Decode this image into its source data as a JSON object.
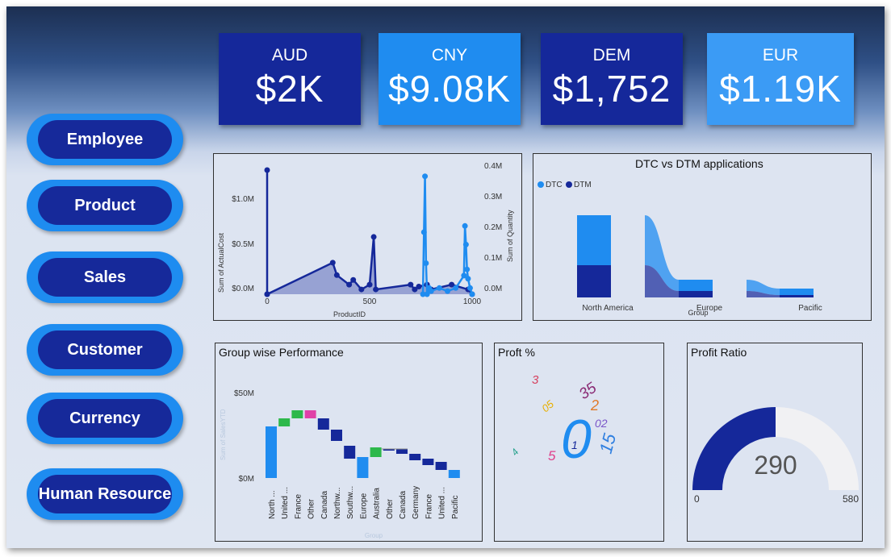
{
  "kpis": [
    {
      "code": "AUD",
      "value": "$2K",
      "color": "#15289a"
    },
    {
      "code": "CNY",
      "value": "$9.08K",
      "color": "#1f8cf0"
    },
    {
      "code": "DEM",
      "value": "$1,752",
      "color": "#15289a"
    },
    {
      "code": "EUR",
      "value": "$1.19K",
      "color": "#3b9bf5"
    }
  ],
  "nav": [
    "Employee",
    "Product",
    "Sales",
    "Customer",
    "Currency",
    "Human Resource"
  ],
  "colors": {
    "dark_blue": "#15289a",
    "mid_blue": "#1f8cf0",
    "light_blue": "#3b9bf5",
    "green": "#2db84b",
    "pink": "#e040a8"
  },
  "cost_chart": {
    "chart_data": {
      "type": "line",
      "xlabel": "ProductID",
      "ylabel": "Sum of ActualCost",
      "y2label": "Sum of Quantity",
      "xticks": [
        "0",
        "500",
        "1000"
      ],
      "yticks": [
        "$0.0M",
        "$0.5M",
        "$1.0M"
      ],
      "y2ticks": [
        "0.0M",
        "0.1M",
        "0.2M",
        "0.3M",
        "0.4M"
      ],
      "xlim": [
        0,
        1000
      ],
      "ylim": [
        0,
        1.3
      ],
      "y2lim": [
        0,
        0.4
      ],
      "series": [
        {
          "axis": "left",
          "color": "#15289a",
          "x": [
            0,
            0,
            0,
            320,
            340,
            400,
            420,
            460,
            500,
            520,
            530,
            700,
            720,
            740,
            780,
            800,
            900,
            980,
            1000
          ],
          "y": [
            0,
            1.3,
            0,
            0.33,
            0.2,
            0.1,
            0.15,
            0.05,
            0.1,
            0.6,
            0.05,
            0.1,
            0.05,
            0.08,
            0.1,
            0.05,
            0.1,
            0.05,
            0
          ]
        },
        {
          "axis": "right",
          "color": "#1f8cf0",
          "x": [
            760,
            765,
            770,
            775,
            780,
            790,
            800,
            840,
            880,
            920,
            960,
            965,
            970,
            975,
            980,
            990,
            1000
          ],
          "y": [
            0.0,
            0.2,
            0.38,
            0.1,
            0.0,
            0.02,
            0.01,
            0.02,
            0.01,
            0.02,
            0.06,
            0.22,
            0.16,
            0.08,
            0.05,
            0.02,
            0.0
          ]
        }
      ]
    }
  },
  "dtc_chart": {
    "title": "DTC vs DTM applications",
    "legend": [
      "DTC",
      "DTM"
    ],
    "chart_data": {
      "type": "bar",
      "xlabel": "Group",
      "categories": [
        "North America",
        "Europe",
        "Pacific"
      ],
      "series": [
        {
          "name": "DTC",
          "values": [
            62,
            14,
            8
          ]
        },
        {
          "name": "DTM",
          "values": [
            40,
            8,
            3
          ]
        }
      ]
    }
  },
  "group_chart": {
    "title": "Group wise Performance",
    "chart_data": {
      "type": "bar",
      "xlabel": "Group",
      "ylabel": "Sum of SalesYTD",
      "yticks": [
        "$0M",
        "$50M"
      ],
      "ylim": [
        0,
        60
      ],
      "categories": [
        "North ...",
        "United ...",
        "France",
        "Other",
        "Canada",
        "Northw...",
        "Southw...",
        "Europe",
        "Australia",
        "Other",
        "Canada",
        "Germany",
        "France",
        "United ...",
        "Pacific"
      ],
      "values": [
        [
          0,
          32
        ],
        [
          32,
          37
        ],
        [
          37,
          42
        ],
        [
          37,
          42
        ],
        [
          30,
          37
        ],
        [
          23,
          30
        ],
        [
          12,
          20
        ],
        [
          0,
          13
        ],
        [
          13,
          19
        ],
        [
          17,
          18
        ],
        [
          15,
          18
        ],
        [
          11,
          15
        ],
        [
          8,
          12
        ],
        [
          5,
          10
        ],
        [
          0,
          5
        ]
      ],
      "bar_colors": [
        "#1f8cf0",
        "#2db84b",
        "#2db84b",
        "#e040a8",
        "#15289a",
        "#15289a",
        "#15289a",
        "#1f8cf0",
        "#2db84b",
        "#15289a",
        "#15289a",
        "#15289a",
        "#15289a",
        "#15289a",
        "#1f8cf0"
      ]
    }
  },
  "profit_pct": {
    "title": "Proft %",
    "words": [
      {
        "text": "3",
        "color": "#d6405e"
      },
      {
        "text": "35",
        "color": "#8a2b74"
      },
      {
        "text": "2",
        "color": "#e07a2a"
      },
      {
        "text": "05",
        "color": "#e8b000"
      },
      {
        "text": "02",
        "color": "#7a55c8"
      },
      {
        "text": "0",
        "color": "#1f8cf0"
      },
      {
        "text": "1",
        "color": "#15289a"
      },
      {
        "text": "15",
        "color": "#2f7fe0"
      },
      {
        "text": "4",
        "color": "#2aa38f"
      },
      {
        "text": "5",
        "color": "#e0408a"
      }
    ]
  },
  "profit_ratio": {
    "title": "Profit Ratio",
    "value": "290",
    "min": "0",
    "max": "580",
    "fraction": 0.5
  }
}
